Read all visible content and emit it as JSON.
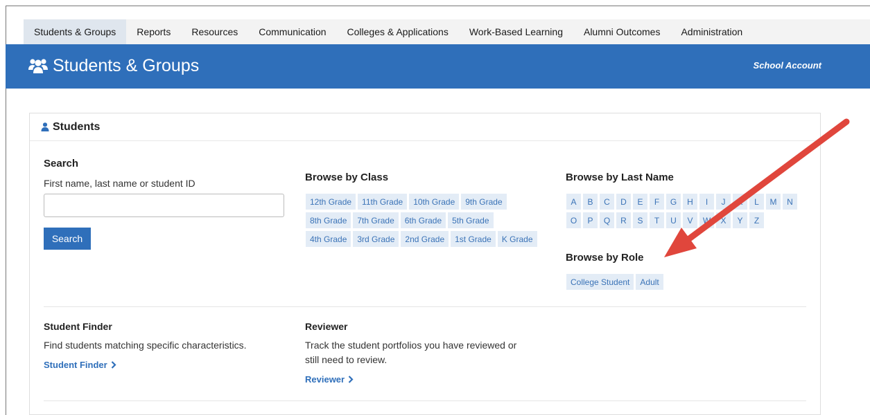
{
  "topnav": {
    "items": [
      {
        "label": "Students & Groups",
        "active": true
      },
      {
        "label": "Reports"
      },
      {
        "label": "Resources"
      },
      {
        "label": "Communication"
      },
      {
        "label": "Colleges & Applications"
      },
      {
        "label": "Work-Based Learning"
      },
      {
        "label": "Alumni Outcomes"
      },
      {
        "label": "Administration"
      }
    ]
  },
  "header": {
    "title": "Students & Groups",
    "account": "School Account",
    "icon": "users-icon"
  },
  "card": {
    "title": "Students",
    "icon": "person-icon"
  },
  "search": {
    "label": "Search",
    "hint": "First name, last name or student ID",
    "value": "",
    "placeholder": "",
    "button": "Search"
  },
  "browse_class": {
    "title": "Browse by Class",
    "rows": [
      [
        "12th Grade",
        "11th Grade",
        "10th Grade",
        "9th Grade"
      ],
      [
        "8th Grade",
        "7th Grade",
        "6th Grade",
        "5th Grade"
      ],
      [
        "4th Grade",
        "3rd Grade",
        "2nd Grade",
        "1st Grade",
        "K Grade"
      ]
    ]
  },
  "browse_last_name": {
    "title": "Browse by Last Name",
    "rows": [
      [
        "A",
        "B",
        "C",
        "D",
        "E",
        "F",
        "G",
        "H",
        "I",
        "J",
        "K",
        "L",
        "M",
        "N"
      ],
      [
        "O",
        "P",
        "Q",
        "R",
        "S",
        "T",
        "U",
        "V",
        "W",
        "X",
        "Y",
        "Z"
      ]
    ]
  },
  "browse_role": {
    "title": "Browse by Role",
    "items": [
      "College Student",
      "Adult"
    ]
  },
  "student_finder": {
    "title": "Student Finder",
    "description": "Find students matching specific characteristics.",
    "link": "Student Finder"
  },
  "reviewer": {
    "title": "Reviewer",
    "description_line1": "Track the student portfolios you have reviewed or",
    "description_line2": "still need to review.",
    "link": "Reviewer"
  },
  "colors": {
    "brand_blue": "#2f6fba",
    "chip_bg": "#e3ecf6",
    "annotation_arrow": "#e0463c"
  }
}
